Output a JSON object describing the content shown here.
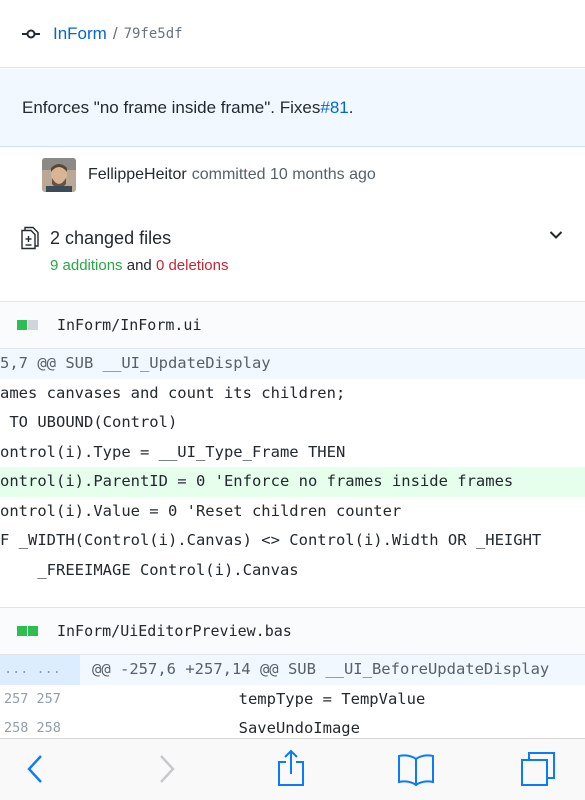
{
  "header": {
    "repo": "InForm",
    "separator": "/",
    "sha": "79fe5df"
  },
  "commit": {
    "message": "Enforces \"no frame inside frame\". Fixes ",
    "issue": "#81",
    "message_end": ".",
    "author": "FellippeHeitor",
    "committed_text": "committed 10 months ago"
  },
  "summary": {
    "changed_files": "2 changed files",
    "additions": "9 additions",
    "and": "and",
    "deletions": "0 deletions"
  },
  "files": [
    {
      "name": "InForm/InForm.ui",
      "lines": [
        {
          "kind": "hunk",
          "text": "5,7 @@ SUB __UI_UpdateDisplay"
        },
        {
          "kind": "ctx",
          "text": "ames canvases and count its children;"
        },
        {
          "kind": "ctx",
          "text": " TO UBOUND(Control)"
        },
        {
          "kind": "ctx",
          "text": "ontrol(i).Type = __UI_Type_Frame THEN"
        },
        {
          "kind": "add",
          "text": "ontrol(i).ParentID = 0 'Enforce no frames inside frames"
        },
        {
          "kind": "ctx",
          "text": "ontrol(i).Value = 0 'Reset children counter"
        },
        {
          "kind": "ctx",
          "text": "F _WIDTH(Control(i).Canvas) <> Control(i).Width OR _HEIGHT"
        },
        {
          "kind": "ctx",
          "text": "    _FREEIMAGE Control(i).Canvas"
        }
      ]
    },
    {
      "name": "InForm/UiEditorPreview.bas",
      "lines": [
        {
          "kind": "hunk",
          "ln": "... ...",
          "text": "@@ -257,6 +257,14 @@ SUB __UI_BeforeUpdateDisplay"
        },
        {
          "kind": "ctx",
          "ln": "257 257",
          "text": "                 tempType = TempValue"
        },
        {
          "kind": "ctx",
          "ln": "258 258",
          "text": "                 SaveUndoImage"
        }
      ]
    }
  ],
  "toolbar": {
    "back": "back-arrow-icon",
    "forward": "forward-arrow-icon",
    "share": "share-icon",
    "bookmarks": "book-icon",
    "tabs": "tabs-icon"
  },
  "colors": {
    "link": "#0366d6",
    "addition": "#28a745",
    "deletion": "#cb2431",
    "add_bg": "#e6ffed",
    "hunk_bg": "#f1f8ff"
  }
}
